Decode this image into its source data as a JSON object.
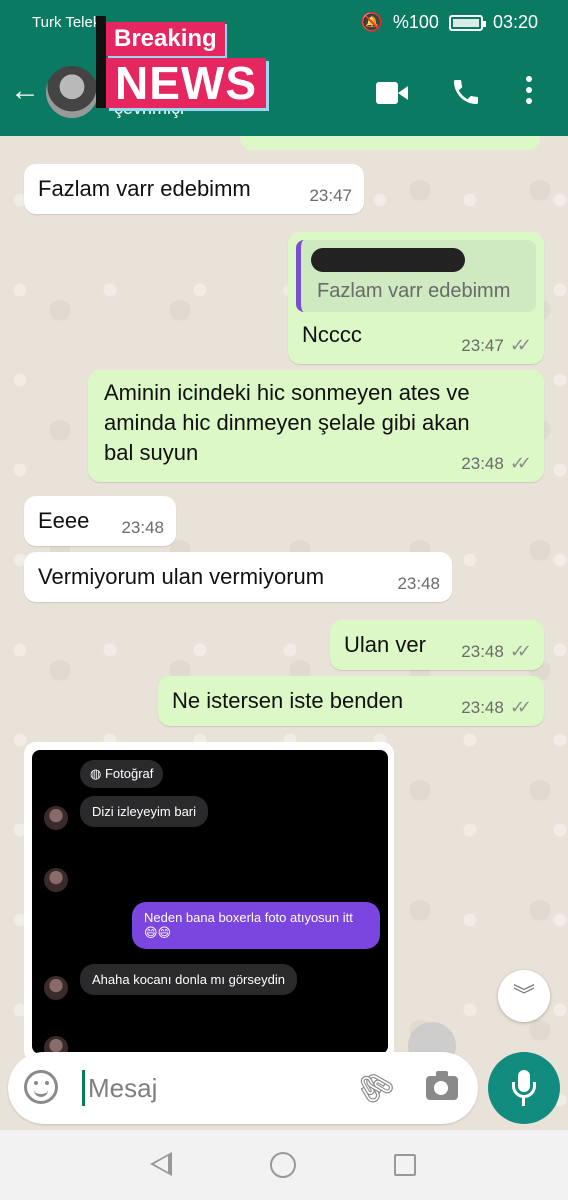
{
  "status_bar": {
    "carrier": "Turk Telek",
    "battery": "%100",
    "time": "03:20"
  },
  "header": {
    "subtitle": "çevrimiçi",
    "overlay_top": "Breaking",
    "overlay_bottom": "NEWS"
  },
  "messages": [
    {
      "direction": "in",
      "text": "Fazlam varr edebimm",
      "time": "23:47"
    },
    {
      "direction": "out",
      "quote": "Fazlam varr edebimm",
      "text": "Ncccc",
      "time": "23:47",
      "ticks": "✓✓"
    },
    {
      "direction": "out",
      "text": "Aminin icindeki hic sonmeyen ates ve aminda hic dinmeyen şelale gibi akan bal suyun",
      "time": "23:48",
      "ticks": "✓✓"
    },
    {
      "direction": "in",
      "text": "Eeee",
      "time": "23:48"
    },
    {
      "direction": "in",
      "text": "Vermiyorum ulan vermiyorum",
      "time": "23:48"
    },
    {
      "direction": "out",
      "text": "Ulan ver",
      "time": "23:48",
      "ticks": "✓✓"
    },
    {
      "direction": "out",
      "text": "Ne istersen iste benden",
      "time": "23:48",
      "ticks": "✓✓"
    }
  ],
  "media": {
    "label": "Fotoğraf",
    "items": [
      {
        "text": "Dizi izleyeyim bari"
      },
      {
        "text": "😂"
      },
      {
        "text": "Neden bana boxerla foto atıyosun itt 😄😄"
      },
      {
        "text": "Ahaha kocanı donla mı görseydin"
      },
      {
        "text": "😏"
      }
    ]
  },
  "composer": {
    "placeholder": "Mesaj"
  },
  "colors": {
    "header": "#0b7a63",
    "outgoing_bubble": "#dcf8c6",
    "incoming_bubble": "#ffffff",
    "mic_button": "#128c7e"
  }
}
